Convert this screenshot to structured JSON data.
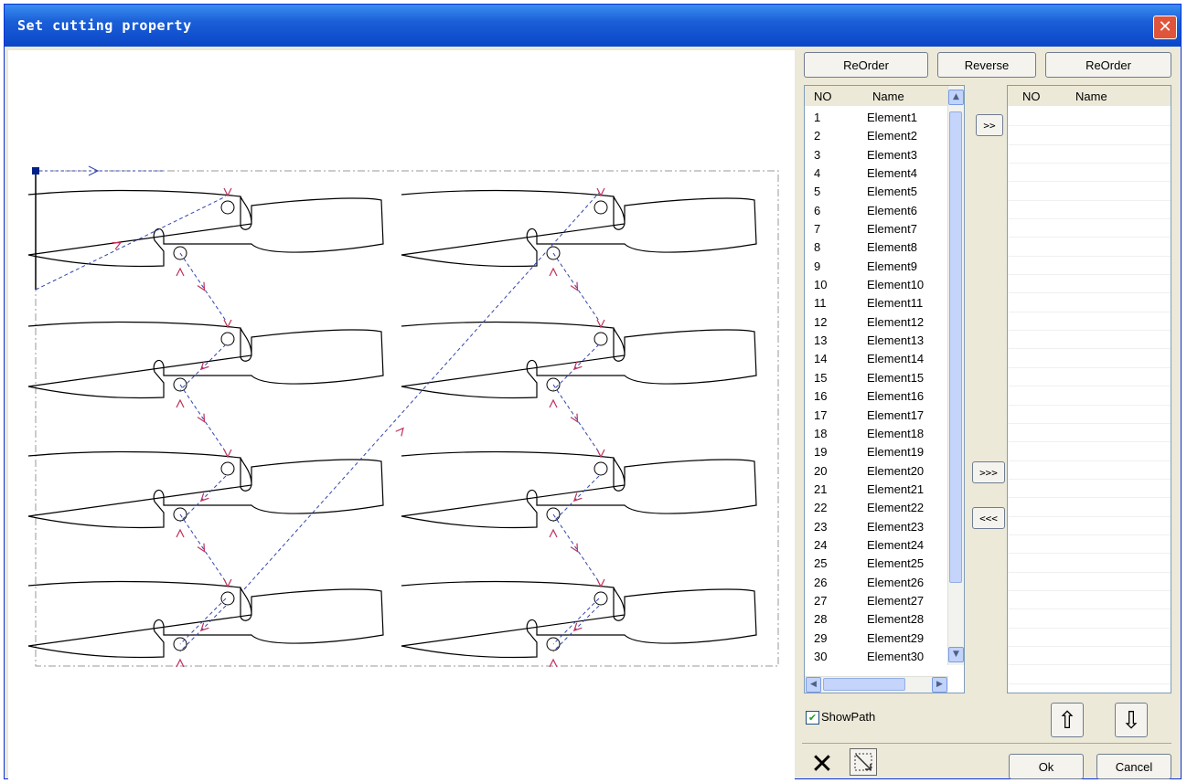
{
  "window": {
    "title": "Set cutting property",
    "close_glyph": "✕"
  },
  "buttons": {
    "reorder_left": "ReOrder",
    "reverse": "Reverse",
    "reorder_right": "ReOrder",
    "move_right": ">>",
    "move_all_right": ">>>",
    "move_all_left": "<<<",
    "ok": "Ok",
    "cancel": "Cancel"
  },
  "left_list": {
    "columns": [
      "NO",
      "Name"
    ],
    "rows": [
      {
        "no": "1",
        "name": "Element1"
      },
      {
        "no": "2",
        "name": "Element2"
      },
      {
        "no": "3",
        "name": "Element3"
      },
      {
        "no": "4",
        "name": "Element4"
      },
      {
        "no": "5",
        "name": "Element5"
      },
      {
        "no": "6",
        "name": "Element6"
      },
      {
        "no": "7",
        "name": "Element7"
      },
      {
        "no": "8",
        "name": "Element8"
      },
      {
        "no": "9",
        "name": "Element9"
      },
      {
        "no": "10",
        "name": "Element10"
      },
      {
        "no": "11",
        "name": "Element11"
      },
      {
        "no": "12",
        "name": "Element12"
      },
      {
        "no": "13",
        "name": "Element13"
      },
      {
        "no": "14",
        "name": "Element14"
      },
      {
        "no": "15",
        "name": "Element15"
      },
      {
        "no": "16",
        "name": "Element16"
      },
      {
        "no": "17",
        "name": "Element17"
      },
      {
        "no": "18",
        "name": "Element18"
      },
      {
        "no": "19",
        "name": "Element19"
      },
      {
        "no": "20",
        "name": "Element20"
      },
      {
        "no": "21",
        "name": "Element21"
      },
      {
        "no": "22",
        "name": "Element22"
      },
      {
        "no": "23",
        "name": "Element23"
      },
      {
        "no": "24",
        "name": "Element24"
      },
      {
        "no": "25",
        "name": "Element25"
      },
      {
        "no": "26",
        "name": "Element26"
      },
      {
        "no": "27",
        "name": "Element27"
      },
      {
        "no": "28",
        "name": "Element28"
      },
      {
        "no": "29",
        "name": "Element29"
      },
      {
        "no": "30",
        "name": "Element30"
      }
    ]
  },
  "right_list": {
    "columns": [
      "NO",
      "Name"
    ],
    "rows": []
  },
  "show_path": {
    "label": "ShowPath",
    "checked": true
  },
  "icons": {
    "delete": "delete-x-icon",
    "select_box": "select-box-icon",
    "move_up": "arrow-up-icon",
    "move_down": "arrow-down-icon"
  },
  "colors": {
    "titlebar": "#1b5fd8",
    "path_arrow": "#c0305a",
    "path_line": "#3344aa"
  }
}
